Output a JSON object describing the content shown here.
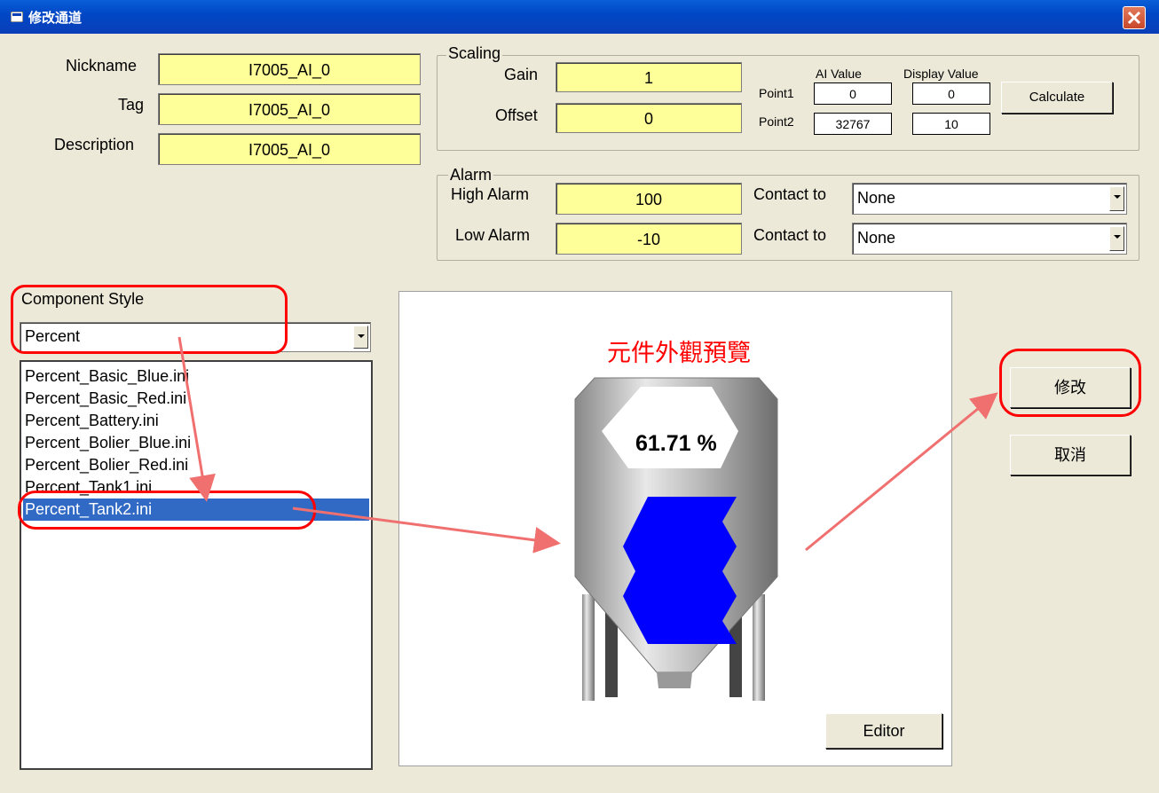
{
  "window": {
    "title": "修改通道"
  },
  "fields": {
    "nickname": {
      "label": "Nickname",
      "value": "I7005_AI_0"
    },
    "tag": {
      "label": "Tag",
      "value": "I7005_AI_0"
    },
    "description": {
      "label": "Description",
      "value": "I7005_AI_0"
    }
  },
  "scaling": {
    "title": "Scaling",
    "gain_label": "Gain",
    "gain_value": "1",
    "offset_label": "Offset",
    "offset_value": "0",
    "ai_value_header": "AI Value",
    "display_value_header": "Display Value",
    "point1_label": "Point1",
    "point1_ai": "0",
    "point1_display": "0",
    "point2_label": "Point2",
    "point2_ai": "32767",
    "point2_display": "10",
    "calculate_label": "Calculate"
  },
  "alarm": {
    "title": "Alarm",
    "high_label": "High Alarm",
    "high_value": "100",
    "low_label": "Low Alarm",
    "low_value": "-10",
    "contact_label": "Contact to",
    "high_contact": "None",
    "low_contact": "None"
  },
  "component": {
    "label": "Component Style",
    "style_value": "Percent",
    "items": [
      "Percent_Basic_Blue.ini",
      "Percent_Basic_Red.ini",
      "Percent_Battery.ini",
      "Percent_Bolier_Blue.ini",
      "Percent_Bolier_Red.ini",
      "Percent_Tank1.ini",
      "Percent_Tank2.ini"
    ],
    "selected_index": 6
  },
  "preview": {
    "title": "元件外觀預覽",
    "percent_text": "61.71 %",
    "fill_level": 0.6171,
    "fill_color": "#0000ff",
    "editor_label": "Editor"
  },
  "buttons": {
    "modify": "修改",
    "cancel": "取消"
  },
  "colors": {
    "accent": "#ff0000",
    "field_bg": "#ffff99",
    "selection": "#316ac5"
  }
}
